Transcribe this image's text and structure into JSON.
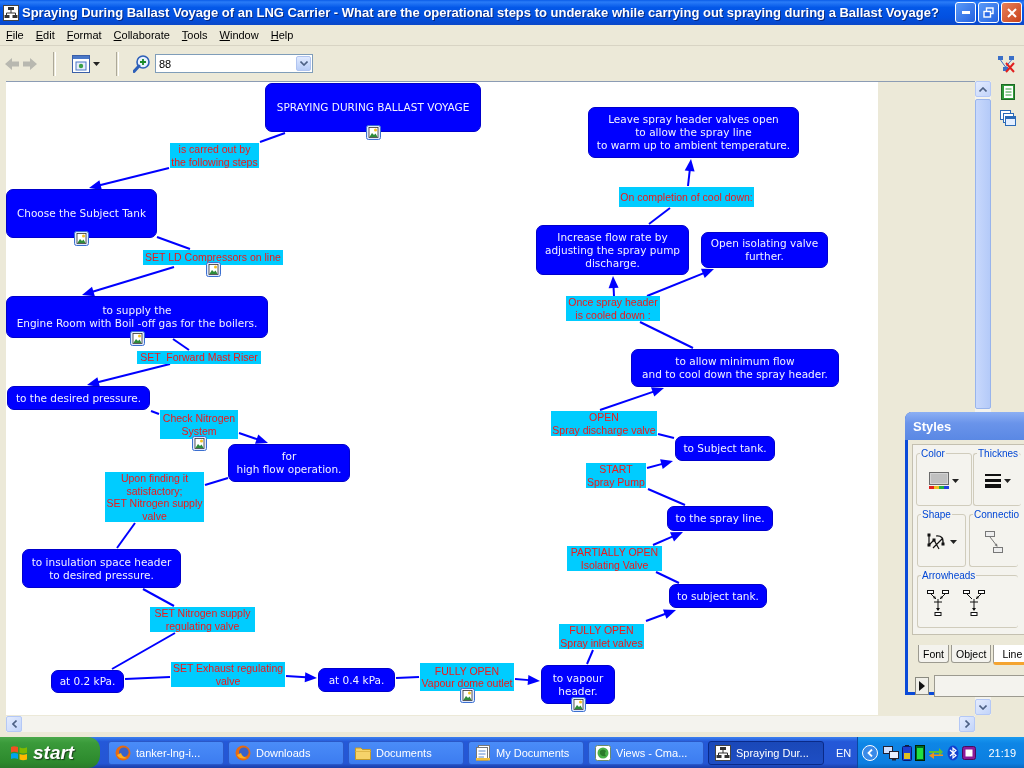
{
  "window": {
    "title": "Spraying During Ballast Voyage of an LNG Carrier - What are the operational steps to underake while carrying out spraying during a Ballast Voyage?"
  },
  "menu": [
    "File",
    "Edit",
    "Format",
    "Collaborate",
    "Tools",
    "Window",
    "Help"
  ],
  "toolbar": {
    "back": {
      "disabled": true
    },
    "forward": {
      "disabled": true
    },
    "zoom": "88"
  },
  "concept_map": {
    "concepts": [
      {
        "text": "SPRAYING DURING BALLAST VOYAGE",
        "image": true
      },
      {
        "text": "Leave spray header valves open\nto allow the spray line\nto warm up to ambient temperature.",
        "image": false
      },
      {
        "text": "Choose the Subject Tank",
        "image": true
      },
      {
        "text": "Increase flow rate by\nadjusting the spray pump\ndischarge.",
        "image": false
      },
      {
        "text": "Open isolating valve\nfurther.",
        "image": false
      },
      {
        "text": "to supply the\nEngine Room with Boil -off gas for the boilers.",
        "image": true
      },
      {
        "text": "to allow minimum flow\nand to cool down the spray header.",
        "image": false
      },
      {
        "text": "to the desired pressure.",
        "image": false
      },
      {
        "text": "to Subject tank.",
        "image": false
      },
      {
        "text": "for\nhigh flow operation.",
        "image": false
      },
      {
        "text": "to the spray line.",
        "image": false
      },
      {
        "text": "to insulation space header\nto desired pressure.",
        "image": false
      },
      {
        "text": "to subject tank.",
        "image": false
      },
      {
        "text": "at 0.2 kPa.",
        "image": false
      },
      {
        "text": "at 0.4 kPa.",
        "image": false
      },
      {
        "text": "to vapour\nheader.",
        "image": true
      }
    ],
    "linking_phrases": [
      {
        "text": "is carred out by\nthe following steps",
        "image": false
      },
      {
        "text": "On completion of cool down:",
        "image": false
      },
      {
        "text": "SET LD Compressors on line",
        "image": true
      },
      {
        "text": "Once spray header\nis cooled down :",
        "image": false
      },
      {
        "text": "SET  Forward Mast Riser",
        "image": false
      },
      {
        "text": "Check Nitrogen\nSystem",
        "image": true
      },
      {
        "text": "OPEN\nSpray discharge valve",
        "image": false
      },
      {
        "text": "START\nSpray Pump",
        "image": false
      },
      {
        "text": "Upon finding it\nsatisfactory;\nSET Nitrogen supply\nvalve",
        "image": false
      },
      {
        "text": "PARTIALLY OPEN\nIsolating Valve",
        "image": false
      },
      {
        "text": "SET Nitrogen supply\nregulating valve",
        "image": false
      },
      {
        "text": "FULLY OPEN\nSpray inlet valves",
        "image": false
      },
      {
        "text": "SET Exhaust regulating\nvalve",
        "image": false
      },
      {
        "text": "FULLY OPEN\nVapour dome outlet",
        "image": true
      }
    ]
  },
  "styles_panel": {
    "title": "Styles",
    "groups": [
      {
        "label": "Color",
        "kind": "color"
      },
      {
        "label": "Thicknes",
        "kind": "thickness"
      },
      {
        "label": "Shape",
        "kind": "shape"
      },
      {
        "label": "Connectio",
        "kind": "connection"
      },
      {
        "label": "Arrowheads",
        "kind": "arrowheads"
      }
    ],
    "tabs": [
      {
        "label": "Font",
        "selected": false
      },
      {
        "label": "Object",
        "selected": false
      },
      {
        "label": "Line",
        "selected": true
      }
    ]
  },
  "taskbar": {
    "start": "start",
    "tasks": [
      {
        "label": "tanker-lng-i...",
        "kind": "browser",
        "selected": false
      },
      {
        "label": "Downloads",
        "kind": "browser",
        "selected": false
      },
      {
        "label": "Documents",
        "kind": "folder",
        "selected": false
      },
      {
        "label": "My Documents",
        "kind": "documents",
        "selected": false
      },
      {
        "label": "Views - Cma...",
        "kind": "views",
        "selected": false
      },
      {
        "label": "Spraying Dur...",
        "kind": "map",
        "selected": true
      }
    ],
    "language": "EN",
    "clock": "21:19"
  }
}
